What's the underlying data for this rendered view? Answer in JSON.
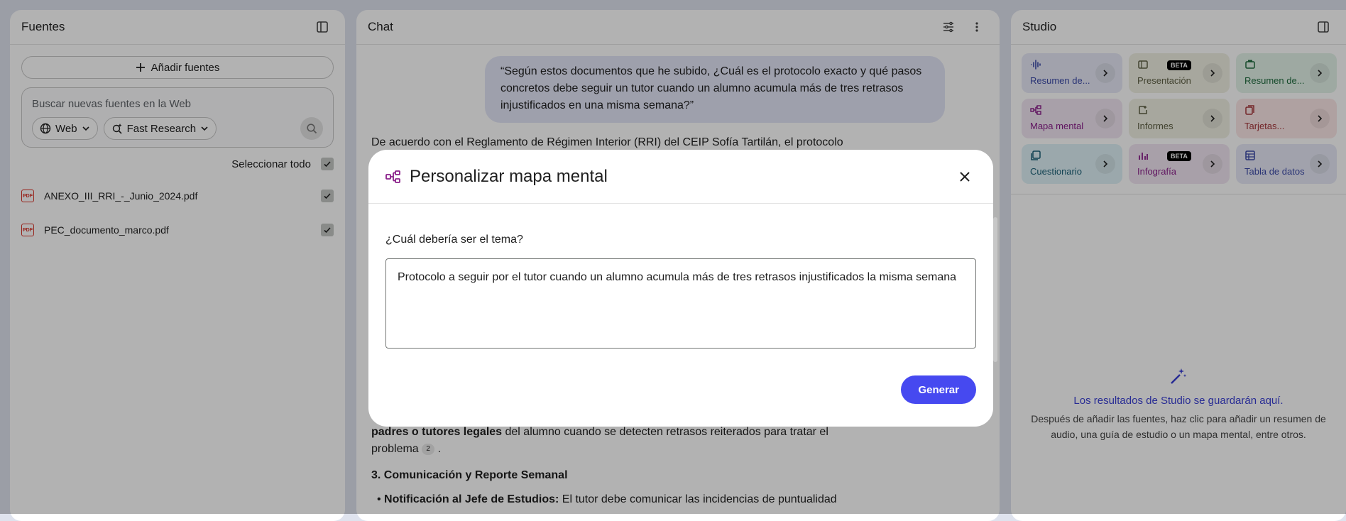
{
  "sources": {
    "title": "Fuentes",
    "add_label": "Añadir fuentes",
    "search_placeholder": "Buscar nuevas fuentes en la Web",
    "web_chip": "Web",
    "research_chip": "Fast Research",
    "select_all": "Seleccionar todo",
    "items": [
      {
        "name": "ANEXO_III_RRI_-_Junio_2024.pdf",
        "icon": "PDF"
      },
      {
        "name": "PEC_documento_marco.pdf",
        "icon": "PDF"
      }
    ]
  },
  "chat": {
    "title": "Chat",
    "user_message": "“Según estos documentos que he subido, ¿Cuál es el protocolo exacto y qué pasos concretos debe seguir un tutor cuando un alumno acumula más de tres retrasos injustificados en una misma semana?”",
    "answer_intro": "De acuerdo con el Reglamento de Régimen Interior (RRI) del CEIP Sofía Tartilán, el protocolo",
    "answer_bold": "padres o tutores legales",
    "answer_rest1": " del alumno cuando se detecten retrasos reiterados para tratar el",
    "answer_rest2": "problema",
    "cite_number": "2",
    "section_heading": "3. Comunicación y Reporte Semanal",
    "bullet_bold": "Notificación al Jefe de Estudios:",
    "bullet_text": " El tutor debe comunicar las incidencias de puntualidad"
  },
  "studio": {
    "title": "Studio",
    "tiles": [
      {
        "label": "Resumen de...",
        "icon": "audio-waveform-icon",
        "bg": "#e7e9f6",
        "color": "#3b4aa8"
      },
      {
        "label": "Presentación",
        "icon": "slides-icon",
        "bg": "#efefe2",
        "color": "#5f6045",
        "badge": "BETA"
      },
      {
        "label": "Resumen de...",
        "icon": "video-icon",
        "bg": "#e3f2e8",
        "color": "#1f6b3e"
      },
      {
        "label": "Mapa mental",
        "icon": "mind-map-icon",
        "bg": "#f1e6f2",
        "color": "#8a1e8a"
      },
      {
        "label": "Informes",
        "icon": "report-icon",
        "bg": "#efefe2",
        "color": "#5f6045"
      },
      {
        "label": "Tarjetas...",
        "icon": "flashcards-icon",
        "bg": "#fbe7e7",
        "color": "#a5353a"
      },
      {
        "label": "Cuestionario",
        "icon": "quiz-icon",
        "bg": "#dff1f6",
        "color": "#1b6078"
      },
      {
        "label": "Infografía",
        "icon": "infographic-icon",
        "bg": "#f1e6f2",
        "color": "#8a1e8a",
        "badge": "BETA"
      },
      {
        "label": "Tabla de datos",
        "icon": "table-icon",
        "bg": "#e7e9f6",
        "color": "#3b4aa8"
      }
    ],
    "empty_title": "Los resultados de Studio se guardarán aquí.",
    "empty_desc": "Después de añadir las fuentes, haz clic para añadir un resumen de audio, una guía de estudio o un mapa mental, entre otros."
  },
  "modal": {
    "title": "Personalizar mapa mental",
    "question": "¿Cuál debería ser el tema?",
    "topic_value": "Protocolo a seguir por el tutor cuando un alumno acumula más de tres retrasos injustificados la misma semana",
    "generate_label": "Generar",
    "accent": "#4649f0",
    "icon_color": "#8a1e8a"
  }
}
